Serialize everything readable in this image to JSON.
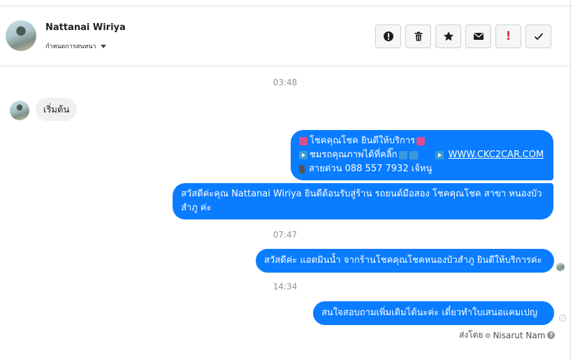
{
  "header": {
    "contact_name": "Nattanai Wiriya",
    "manage_label": "กำหนดการสนทนา",
    "actions": [
      {
        "name": "report-icon",
        "glyph": "!"
      },
      {
        "name": "trash-icon"
      },
      {
        "name": "star-icon"
      },
      {
        "name": "mail-icon"
      },
      {
        "name": "spam-icon",
        "glyph": "!"
      },
      {
        "name": "check-icon"
      }
    ]
  },
  "timestamps": {
    "t1": "03:48",
    "t2": "07:47",
    "t3": "14:34"
  },
  "messages": {
    "incoming_1": "เริ่มต้น",
    "out_1_line1": "โชคคุณโชค ยินดีให้บริการ",
    "out_1_line2_text": "ชมรถคุณภาพได้ที่คลิ๊ก",
    "out_1_link": "WWW.CKC2CAR.COM",
    "out_1_line3": "สายด่วน 088 557 7932 เจ้หนู",
    "out_2": "สวัสดีค่ะคุณ Nattanai Wiriya ยินดีต้อนรับสู่ร้าน รถยนต์มือสอง โชคคุณโชค สาขา หนองบัวสำภู ค่ะ",
    "out_3": "สวัสดีค่ะ แอดมินน้ำ จากร้านโชคคุณโชคหนองบัวสำภู ยินดีให้บริการค่ะ",
    "out_4": "สนใจสอบถามเพิ่มเติมได้นะค่ะ เดี๋ยวทำใบเสนอแคมเปญ"
  },
  "sent_by": {
    "label": "ส่งโดย",
    "name": "Nisarut Nam",
    "help": "?"
  },
  "colors": {
    "outgoing_bubble": "#0a7cff",
    "incoming_bubble": "#f1f0f0",
    "spam_red": "#e0393e"
  }
}
